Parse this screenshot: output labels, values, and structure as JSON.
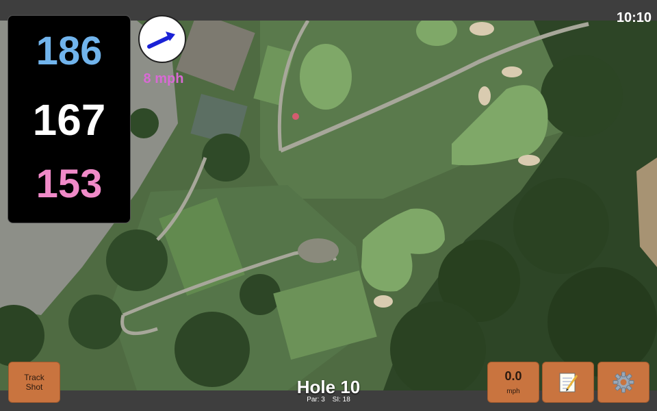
{
  "status": {
    "time": "10:10"
  },
  "yardages": {
    "back": "186",
    "middle": "167",
    "front": "153"
  },
  "wind": {
    "speed_label": "8 mph",
    "direction": "east-northeast"
  },
  "hole": {
    "title": "Hole 10",
    "par_label": "Par: 3",
    "si_label": "SI: 18"
  },
  "buttons": {
    "track_shot_line1": "Track",
    "track_shot_line2": "Shot",
    "speed_value": "0.0",
    "speed_unit": "mph",
    "notes_icon": "notepad-icon",
    "settings_icon": "gear-icon"
  },
  "colors": {
    "back_yardage": "#71b4ec",
    "middle_yardage": "#ffffff",
    "front_yardage": "#f08ac8",
    "wind_text": "#d86ad4",
    "button": "#c9743f",
    "wind_arrow": "#1a22d6"
  }
}
